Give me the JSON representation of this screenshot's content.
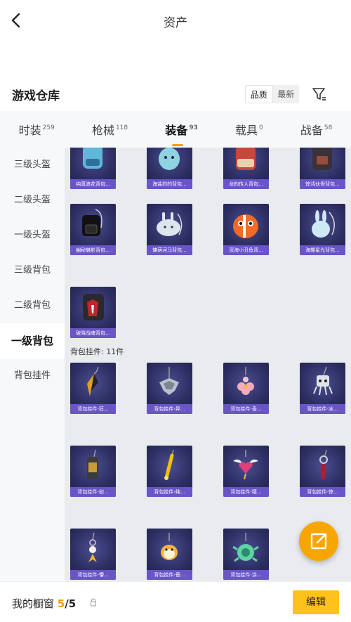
{
  "header": {
    "title": "资产"
  },
  "section": {
    "title": "游戏仓库",
    "sort_options": [
      "品质",
      "最新"
    ]
  },
  "tabs": [
    {
      "label": "时装",
      "count": "259"
    },
    {
      "label": "枪械",
      "count": "118"
    },
    {
      "label": "装备",
      "count": "93"
    },
    {
      "label": "载具",
      "count": "0"
    },
    {
      "label": "战备",
      "count": "58"
    }
  ],
  "sidebar": [
    "三级头盔",
    "二级头盔",
    "一级头盔",
    "三级背包",
    "二级背包",
    "一级背包",
    "背包挂件"
  ],
  "items_row0": [
    "纯真浪花背包...",
    "海盐豹的背包...",
    "龙的传人背包...",
    "惊鸿伙骨背包..."
  ],
  "items_row1": [
    "幽秘魅影背包...",
    "慵萌河马背包...",
    "深海小丑鱼背...",
    "海螺星光背包..."
  ],
  "items_row2": [
    "破晓战魂背包..."
  ],
  "pendant_label": "背包挂件: 11件",
  "pendants_row0": [
    "背包挂件-狂...",
    "背包挂件-异...",
    "背包挂件-香...",
    "背包挂件-冰..."
  ],
  "pendants_row1": [
    "背包挂件-创...",
    "背包挂件-纯...",
    "背包挂件-精...",
    "背包挂件-惊..."
  ],
  "pendants_row2": [
    "背包挂件-懵...",
    "背包挂件-垂...",
    "背包挂件-涂..."
  ],
  "bottom": {
    "label": "我的橱窗",
    "current": "5",
    "sep": "/",
    "max": "5",
    "edit": "编辑"
  },
  "colors": {
    "accent": "#f7a600",
    "caption_bg": "#6a55c8",
    "edit_bg": "#ffc21a"
  }
}
